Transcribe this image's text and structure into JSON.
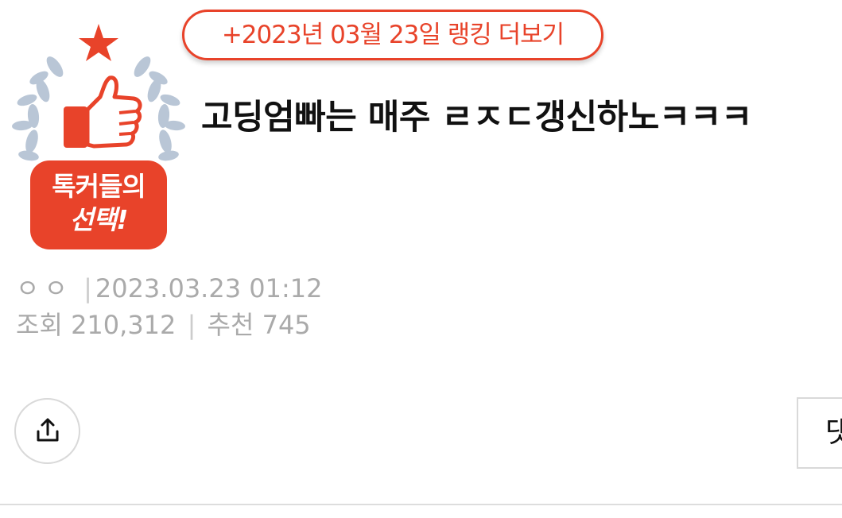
{
  "ranking": {
    "label": "+2023년 03월 23일 랭킹 더보기"
  },
  "badge": {
    "line1": "톡커들의",
    "line2": "선택!"
  },
  "post": {
    "title": "고딩엄빠는 매주 ㄹㅈㄷ갱신하노ㅋㅋㅋ",
    "author": "ㅇㅇ",
    "date": "2023.03.23 01:12",
    "views_label": "조회",
    "views": "210,312",
    "recommend_label": "추천",
    "recommend": "745",
    "separator": "|"
  },
  "actions": {
    "reply_label": "댓"
  },
  "colors": {
    "accent": "#e8432a",
    "meta_text": "#aaaaaa",
    "laurel": "#b9c6d6"
  },
  "icons": {
    "share": "share-icon",
    "badge_star": "star-icon",
    "badge_thumb": "thumbs-up-icon",
    "badge_laurel": "laurel-icon"
  }
}
